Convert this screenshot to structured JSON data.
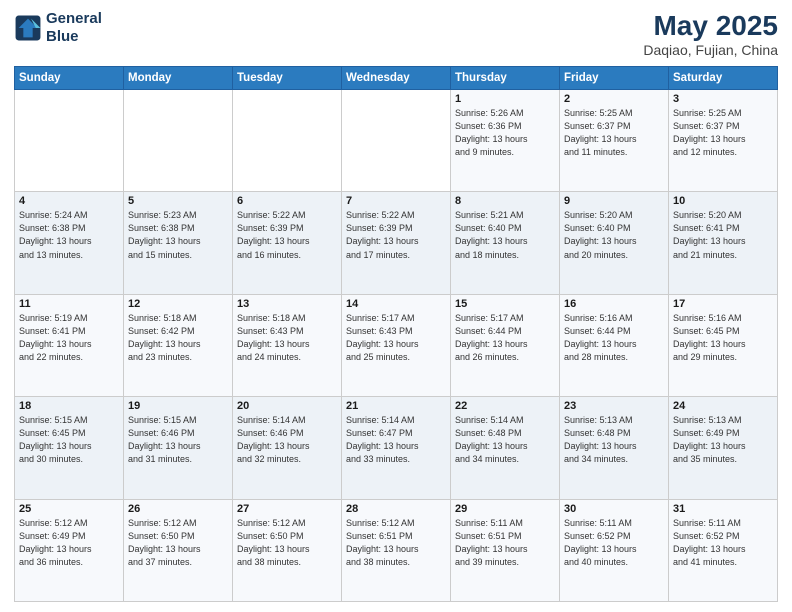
{
  "header": {
    "logo_line1": "General",
    "logo_line2": "Blue",
    "month_year": "May 2025",
    "location": "Daqiao, Fujian, China"
  },
  "days_of_week": [
    "Sunday",
    "Monday",
    "Tuesday",
    "Wednesday",
    "Thursday",
    "Friday",
    "Saturday"
  ],
  "weeks": [
    [
      {
        "day": "",
        "info": ""
      },
      {
        "day": "",
        "info": ""
      },
      {
        "day": "",
        "info": ""
      },
      {
        "day": "",
        "info": ""
      },
      {
        "day": "1",
        "info": "Sunrise: 5:26 AM\nSunset: 6:36 PM\nDaylight: 13 hours\nand 9 minutes."
      },
      {
        "day": "2",
        "info": "Sunrise: 5:25 AM\nSunset: 6:37 PM\nDaylight: 13 hours\nand 11 minutes."
      },
      {
        "day": "3",
        "info": "Sunrise: 5:25 AM\nSunset: 6:37 PM\nDaylight: 13 hours\nand 12 minutes."
      }
    ],
    [
      {
        "day": "4",
        "info": "Sunrise: 5:24 AM\nSunset: 6:38 PM\nDaylight: 13 hours\nand 13 minutes."
      },
      {
        "day": "5",
        "info": "Sunrise: 5:23 AM\nSunset: 6:38 PM\nDaylight: 13 hours\nand 15 minutes."
      },
      {
        "day": "6",
        "info": "Sunrise: 5:22 AM\nSunset: 6:39 PM\nDaylight: 13 hours\nand 16 minutes."
      },
      {
        "day": "7",
        "info": "Sunrise: 5:22 AM\nSunset: 6:39 PM\nDaylight: 13 hours\nand 17 minutes."
      },
      {
        "day": "8",
        "info": "Sunrise: 5:21 AM\nSunset: 6:40 PM\nDaylight: 13 hours\nand 18 minutes."
      },
      {
        "day": "9",
        "info": "Sunrise: 5:20 AM\nSunset: 6:40 PM\nDaylight: 13 hours\nand 20 minutes."
      },
      {
        "day": "10",
        "info": "Sunrise: 5:20 AM\nSunset: 6:41 PM\nDaylight: 13 hours\nand 21 minutes."
      }
    ],
    [
      {
        "day": "11",
        "info": "Sunrise: 5:19 AM\nSunset: 6:41 PM\nDaylight: 13 hours\nand 22 minutes."
      },
      {
        "day": "12",
        "info": "Sunrise: 5:18 AM\nSunset: 6:42 PM\nDaylight: 13 hours\nand 23 minutes."
      },
      {
        "day": "13",
        "info": "Sunrise: 5:18 AM\nSunset: 6:43 PM\nDaylight: 13 hours\nand 24 minutes."
      },
      {
        "day": "14",
        "info": "Sunrise: 5:17 AM\nSunset: 6:43 PM\nDaylight: 13 hours\nand 25 minutes."
      },
      {
        "day": "15",
        "info": "Sunrise: 5:17 AM\nSunset: 6:44 PM\nDaylight: 13 hours\nand 26 minutes."
      },
      {
        "day": "16",
        "info": "Sunrise: 5:16 AM\nSunset: 6:44 PM\nDaylight: 13 hours\nand 28 minutes."
      },
      {
        "day": "17",
        "info": "Sunrise: 5:16 AM\nSunset: 6:45 PM\nDaylight: 13 hours\nand 29 minutes."
      }
    ],
    [
      {
        "day": "18",
        "info": "Sunrise: 5:15 AM\nSunset: 6:45 PM\nDaylight: 13 hours\nand 30 minutes."
      },
      {
        "day": "19",
        "info": "Sunrise: 5:15 AM\nSunset: 6:46 PM\nDaylight: 13 hours\nand 31 minutes."
      },
      {
        "day": "20",
        "info": "Sunrise: 5:14 AM\nSunset: 6:46 PM\nDaylight: 13 hours\nand 32 minutes."
      },
      {
        "day": "21",
        "info": "Sunrise: 5:14 AM\nSunset: 6:47 PM\nDaylight: 13 hours\nand 33 minutes."
      },
      {
        "day": "22",
        "info": "Sunrise: 5:14 AM\nSunset: 6:48 PM\nDaylight: 13 hours\nand 34 minutes."
      },
      {
        "day": "23",
        "info": "Sunrise: 5:13 AM\nSunset: 6:48 PM\nDaylight: 13 hours\nand 34 minutes."
      },
      {
        "day": "24",
        "info": "Sunrise: 5:13 AM\nSunset: 6:49 PM\nDaylight: 13 hours\nand 35 minutes."
      }
    ],
    [
      {
        "day": "25",
        "info": "Sunrise: 5:12 AM\nSunset: 6:49 PM\nDaylight: 13 hours\nand 36 minutes."
      },
      {
        "day": "26",
        "info": "Sunrise: 5:12 AM\nSunset: 6:50 PM\nDaylight: 13 hours\nand 37 minutes."
      },
      {
        "day": "27",
        "info": "Sunrise: 5:12 AM\nSunset: 6:50 PM\nDaylight: 13 hours\nand 38 minutes."
      },
      {
        "day": "28",
        "info": "Sunrise: 5:12 AM\nSunset: 6:51 PM\nDaylight: 13 hours\nand 38 minutes."
      },
      {
        "day": "29",
        "info": "Sunrise: 5:11 AM\nSunset: 6:51 PM\nDaylight: 13 hours\nand 39 minutes."
      },
      {
        "day": "30",
        "info": "Sunrise: 5:11 AM\nSunset: 6:52 PM\nDaylight: 13 hours\nand 40 minutes."
      },
      {
        "day": "31",
        "info": "Sunrise: 5:11 AM\nSunset: 6:52 PM\nDaylight: 13 hours\nand 41 minutes."
      }
    ]
  ]
}
